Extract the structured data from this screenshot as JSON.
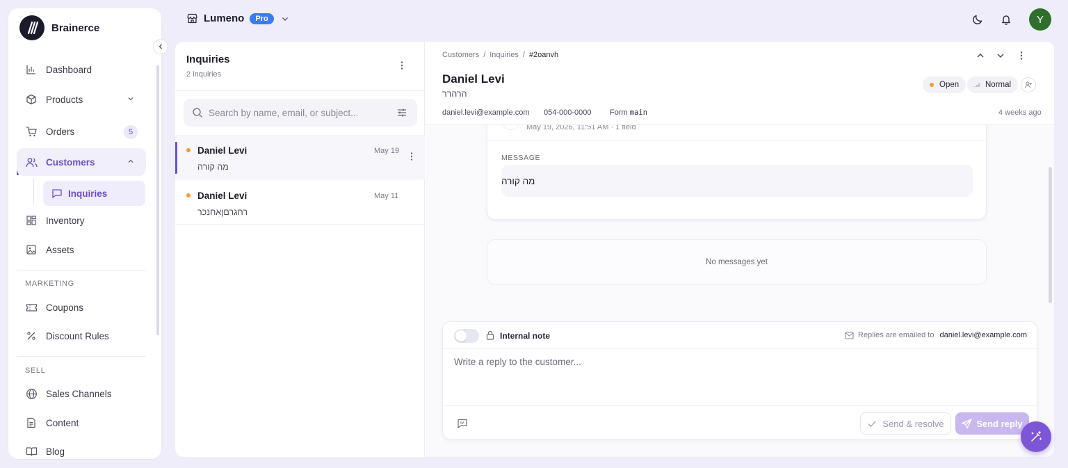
{
  "brand": {
    "name": "Brainerce"
  },
  "sidebar": {
    "items": [
      {
        "label": "Dashboard",
        "icon": "chart-bars-icon"
      },
      {
        "label": "Products",
        "icon": "box-icon"
      },
      {
        "label": "Orders",
        "icon": "cart-icon",
        "badge": "5"
      },
      {
        "label": "Customers",
        "icon": "users-icon"
      },
      {
        "label": "Inquiries",
        "icon": "message-square-icon"
      },
      {
        "label": "Inventory",
        "icon": "grid-icon"
      },
      {
        "label": "Assets",
        "icon": "image-icon"
      }
    ],
    "marketing_label": "MARKETING",
    "marketing_items": [
      {
        "label": "Coupons",
        "icon": "ticket-icon"
      },
      {
        "label": "Discount Rules",
        "icon": "percent-icon"
      }
    ],
    "sell_label": "SELL",
    "sell_items": [
      {
        "label": "Sales Channels",
        "icon": "globe-icon"
      },
      {
        "label": "Content",
        "icon": "document-icon"
      },
      {
        "label": "Blog",
        "icon": "book-icon"
      }
    ]
  },
  "topbar": {
    "store_name": "Lumeno",
    "plan_badge": "Pro",
    "avatar_initial": "Y"
  },
  "inquiries": {
    "title": "Inquiries",
    "count_label": "2 inquiries",
    "search_placeholder": "Search by name, email, or subject...",
    "rows": [
      {
        "name": "Daniel Levi",
        "snippet": "מה קורה",
        "date": "May 19"
      },
      {
        "name": "Daniel Levi",
        "snippet": "רחגרםןאחנכר",
        "date": "May 11"
      }
    ]
  },
  "detail": {
    "breadcrumb": [
      "Customers",
      "Inquiries",
      "#2oanvh"
    ],
    "name": "Daniel Levi",
    "subject": "הרהרר",
    "status": "Open",
    "priority": "Normal",
    "email": "daniel.levi@example.com",
    "phone": "054-000-0000",
    "form_label": "Form",
    "form_value": "main",
    "time_ago": "4 weeks ago",
    "message_meta": "May 19, 2026, 11:51 AM · 1 field",
    "message_label": "MESSAGE",
    "message_text": "מה קורה",
    "empty_thread": "No messages yet"
  },
  "composer": {
    "internal_note_label": "Internal note",
    "replies_label": "Replies are emailed to",
    "replies_email": "daniel.levi@example.com",
    "placeholder": "Write a reply to the customer...",
    "resolve_label": "Send & resolve",
    "send_label": "Send reply"
  },
  "colors": {
    "accent": "#6b4fc8",
    "pro_badge": "#3b7bf1",
    "status_dot": "#f0a02c",
    "avatar": "#2f6e2b"
  }
}
